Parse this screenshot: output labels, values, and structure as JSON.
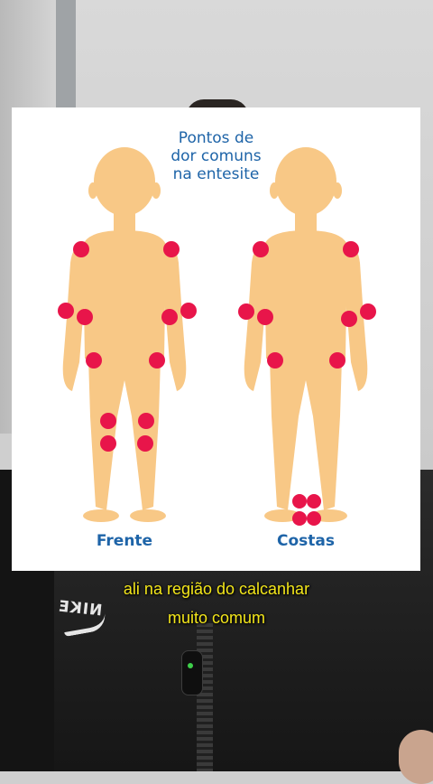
{
  "infographic": {
    "title_lines": [
      "Pontos de",
      "dor comuns",
      "na entesite"
    ],
    "front_label": "Frente",
    "back_label": "Costas",
    "body_color": "#f8c886",
    "dot_color": "#e8154a",
    "title_color": "#1e64a8"
  },
  "captions": {
    "line1": "ali na região do calcanhar",
    "line2": "muito comum",
    "color": "#f3e61a"
  },
  "jacket": {
    "brand_text": "NIKE"
  }
}
